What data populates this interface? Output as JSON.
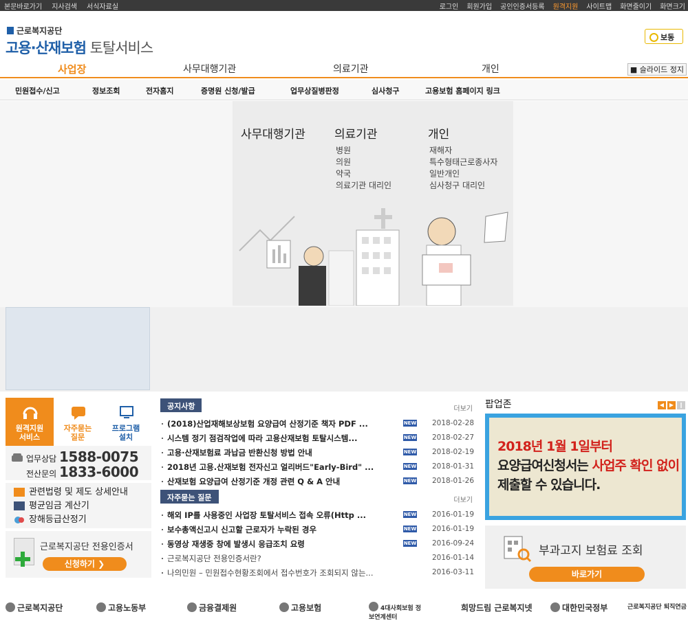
{
  "topbar": {
    "left": [
      "본문바로가기",
      "지사검색",
      "서식자료실"
    ],
    "right": [
      "로그인",
      "회원가입",
      "공인인증서등록",
      "원격지원",
      "사이트맵",
      "화면줄이기",
      "화면크기"
    ]
  },
  "header": {
    "org": "근로복지공단",
    "title_bold": "고용·산재보험",
    "title_rest": "토탈서비스",
    "voice_label": "보동"
  },
  "mainnav": {
    "tabs": [
      "사업장",
      "사무대행기관",
      "의료기관",
      "개인"
    ],
    "slide_stop": "슬라이드 정지"
  },
  "subnav": [
    "민원접수/신고",
    "정보조회",
    "전자홈지",
    "증명원 신청/발급",
    "업무상질병판정",
    "심사청구",
    "고용보험 홈페이지 링크"
  ],
  "hero": {
    "cols": [
      {
        "title": "사무대행기관",
        "items": []
      },
      {
        "title": "의료기관",
        "items": [
          "병원",
          "의원",
          "약국",
          "의료기관 대리인"
        ]
      },
      {
        "title": "개인",
        "items": [
          "재해자",
          "특수형태근로종사자",
          "일반개인",
          "심사청구 대리인"
        ]
      }
    ]
  },
  "quick": {
    "icons": [
      "원격지원\n서비스",
      "자주묻는\n질문",
      "프로그램\n설치"
    ],
    "phone1_label": "업무상담",
    "phone1": "1588-0075",
    "phone2_label": "전산문의",
    "phone2": "1833-6000",
    "links": [
      "관련법령 및 제도 상세안내",
      "평균임금 계산기",
      "장해등급산정기"
    ],
    "cert_title": "근로복지공단 전용인증서",
    "cert_button": "신청하기 ❯"
  },
  "notice": {
    "label": "공지사항",
    "more": "더보기",
    "items": [
      {
        "title": "(2018)산업재해보상보험 요양급여 산정기준 책자 PDF ...",
        "date": "2018-02-28",
        "new": "NEW"
      },
      {
        "title": "시스템 정기 점검작업에 따라 고용산재보험 토탈시스템...",
        "date": "2018-02-27",
        "new": "NEW"
      },
      {
        "title": "고용·산재보험료 과납금 반환신청 방법 안내",
        "date": "2018-02-19",
        "new": "NEW"
      },
      {
        "title": "2018년 고용.산재보험 전자신고 얼리버드\"Early-Bird\" ...",
        "date": "2018-01-31",
        "new": "NEW"
      },
      {
        "title": "산재보험 요양급여 산정기준 개정 관련 Q & A 안내",
        "date": "2018-01-26",
        "new": "NEW"
      }
    ]
  },
  "faq": {
    "label": "자주묻는 질문",
    "more": "더보기",
    "items": [
      {
        "title": "해외 IP를 사용중인 사업장 토탈서비스 접속 오류(Http ...",
        "date": "2016-01-19",
        "new": "NEW",
        "plain": false
      },
      {
        "title": "보수총액신고시 신고할 근로자가 누락된 경우",
        "date": "2016-01-19",
        "new": "NEW",
        "plain": false
      },
      {
        "title": "동영상 재생중 창에 발생시 응급조치 요령",
        "date": "2016-09-24",
        "new": "NEW",
        "plain": false
      },
      {
        "title": "근로복지공단 전용인증서란?",
        "date": "2016-01-14",
        "new": "",
        "plain": true
      },
      {
        "title": "나의민원 – 민원접수현황조회에서 접수번호가 조회되지 않는...",
        "date": "2016-03-11",
        "new": "",
        "plain": true
      }
    ]
  },
  "popup": {
    "title": "팝업존",
    "line1": "2018년 1월 1일부터",
    "line2a": "요양급여신청서는",
    "line2b": "사업주 확인 없이",
    "line3": "제출할 수 있습니다.",
    "fee_title": "부과고지 보험료 조회",
    "fee_button": "바로가기"
  },
  "footer": [
    "근로복지공단",
    "고용노동부",
    "금융결제원",
    "고용보험",
    "4대사회보험 정보연계센터",
    "희망드림 근로복지넷",
    "대한민국정부",
    "근로복지공단 퇴직연금"
  ],
  "colors": {
    "accent": "#f08c1c",
    "navy": "#3d5278",
    "brand": "#1f5fa8"
  }
}
